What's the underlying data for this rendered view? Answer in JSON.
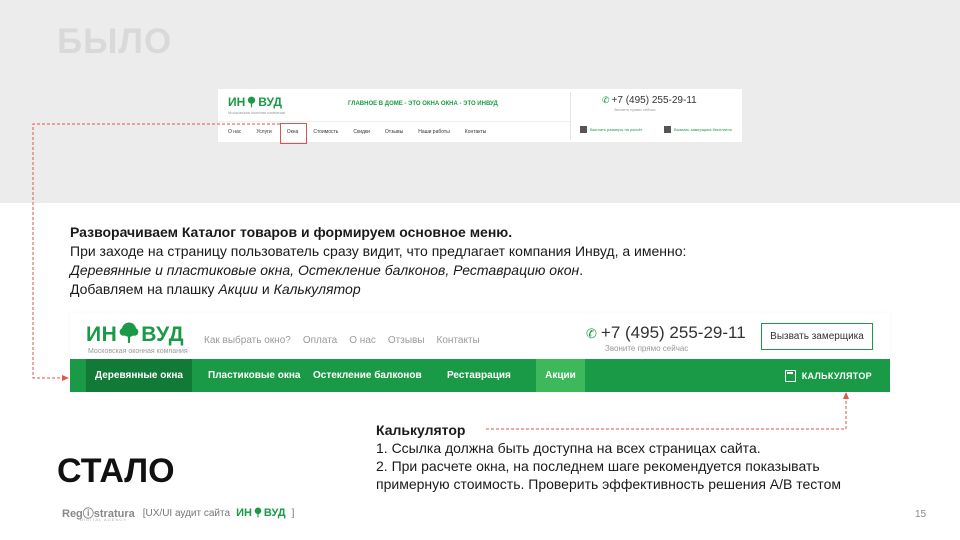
{
  "slide": {
    "was_title": "БЫЛО",
    "became_title": "СТАЛО",
    "page_number": "15"
  },
  "old_header": {
    "logo": [
      "ИН",
      "ВУД"
    ],
    "subtitle": "Московская оконная компания",
    "slogan": "ГЛАВНОЕ В ДОМЕ - ЭТО ОКНА   ОКНА - ЭТО ИНВУД",
    "phone": "+7 (495) 255-29-11",
    "phone_sub": "Звоните прямо сейчас",
    "nav": [
      "О нас",
      "Услуги",
      "Окна",
      "Стоимость",
      "Скидки",
      "Отзывы",
      "Наши работы",
      "Контакты"
    ],
    "action_1": "Выслать размеры на расчёт",
    "action_2": "Вызвать замерщика бесплатно"
  },
  "description": {
    "line1": "Разворачиваем Каталог товаров и формируем основное меню.",
    "line2": "При заходе на страницу пользователь сразу видит, что предлагает компания Инвуд, а именно:",
    "line3_italic": "Деревянные и пластиковые окна, Остекление балконов, Реставрацию окон",
    "line3_end": ".",
    "line4_start": "Добавляем на плашку ",
    "line4_italic1": "Акции",
    "line4_mid": " и ",
    "line4_italic2": "Калькулятор"
  },
  "new_header": {
    "logo": [
      "ИН",
      "ВУД"
    ],
    "subtitle": "Московская оконная компания",
    "top_nav": [
      "Как выбрать окно?",
      "Оплата",
      "О нас",
      "Отзывы",
      "Контакты"
    ],
    "phone": "+7 (495) 255-29-11",
    "phone_sub": "Звоните прямо сейчас",
    "call_button": "Вызвать замерщика",
    "menu": [
      "Деревянные окна",
      "Пластиковые окна",
      "Остекление балконов",
      "Реставрация",
      "Акции"
    ],
    "calculator": "КАЛЬКУЛЯТОР"
  },
  "calc_note": {
    "title": "Калькулятор",
    "item1": "1. Ссылка должна быть доступна на всех страницах сайта.",
    "item2": "2. При расчете окна, на последнем шаге рекомендуется показывать примерную стоимость.  Проверить эффективность решения А/В тестом"
  },
  "footer": {
    "logo": "Regⓘstratura",
    "logo_sub": "DIGITAL AGENCY",
    "audit_text": "[UX/UI аудит сайта",
    "brand": [
      "ИН",
      "ВУД"
    ],
    "close_bracket": "]"
  },
  "colors": {
    "brand_green": "#1a9a46",
    "dark_green": "#127a37",
    "light_green": "#3db85a",
    "annotation_red": "#e0564a"
  }
}
